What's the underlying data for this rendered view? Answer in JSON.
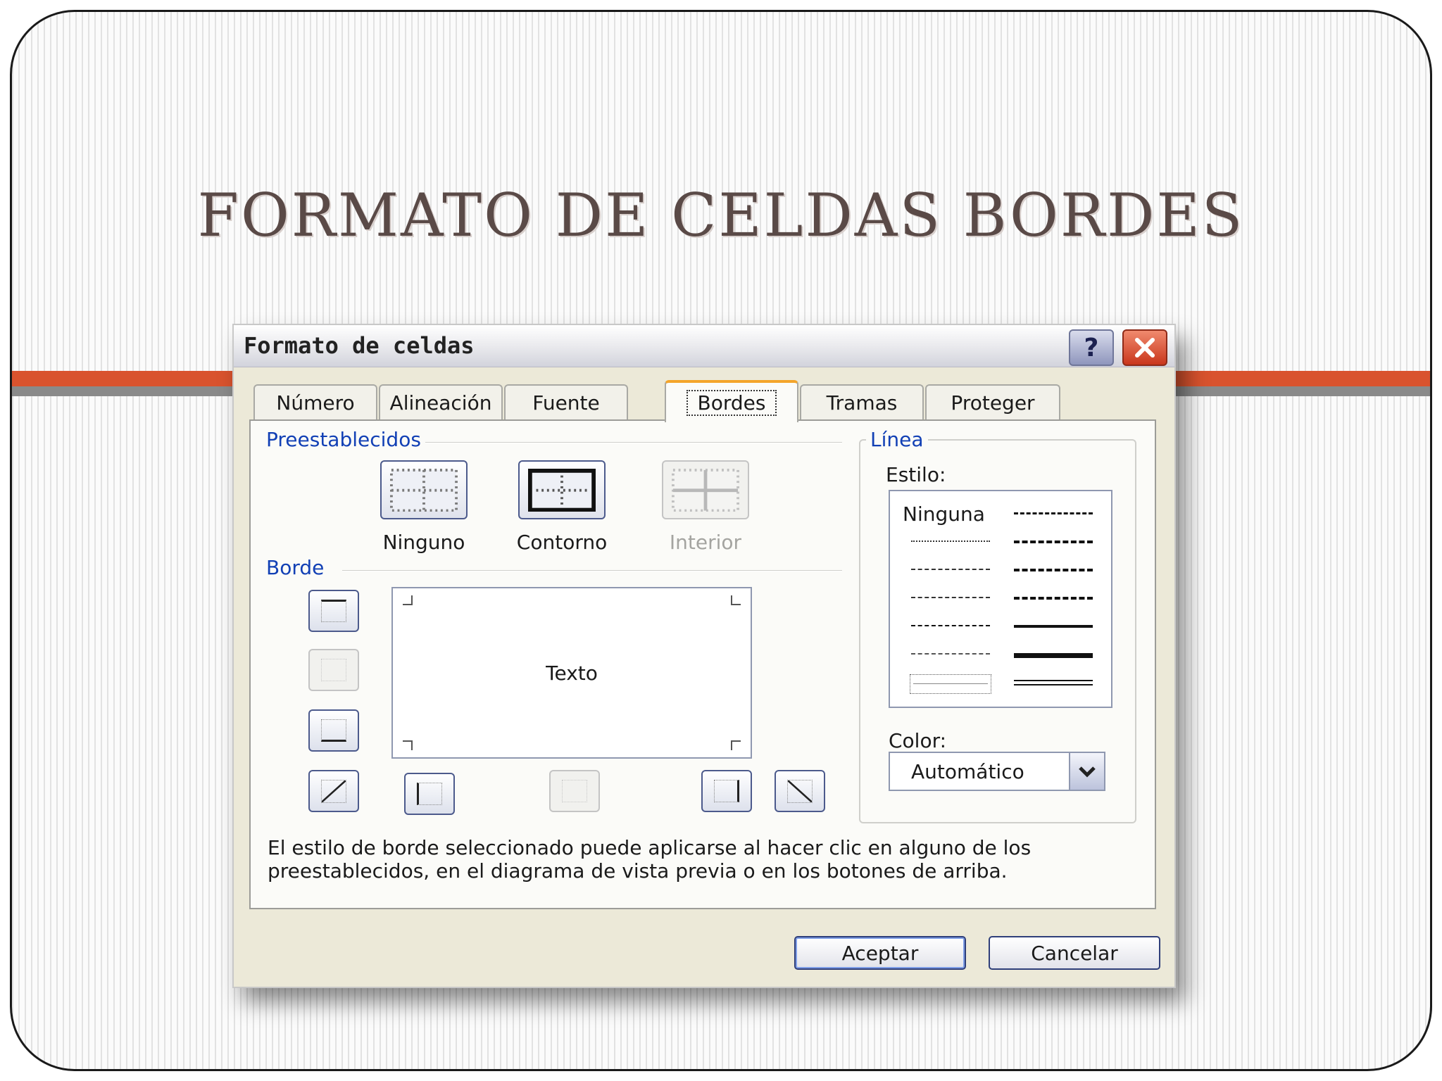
{
  "slide": {
    "title": "FORMATO DE CELDAS BORDES"
  },
  "dialog": {
    "title": "Formato de celdas",
    "help_label": "?",
    "tabs": [
      {
        "label": "Número"
      },
      {
        "label": "Alineación"
      },
      {
        "label": "Fuente"
      },
      {
        "label": "Bordes",
        "active": true
      },
      {
        "label": "Tramas"
      },
      {
        "label": "Proteger"
      }
    ],
    "presets": {
      "group_label": "Preestablecidos",
      "items": [
        {
          "label": "Ninguno",
          "icon": "preset-none-icon"
        },
        {
          "label": "Contorno",
          "icon": "preset-outline-icon"
        },
        {
          "label": "Interior",
          "icon": "preset-inside-icon",
          "disabled": true
        }
      ]
    },
    "border": {
      "group_label": "Borde",
      "preview_text": "Texto"
    },
    "line": {
      "group_label": "Línea",
      "style_label": "Estilo:",
      "none_option": "Ninguna",
      "color_label": "Color:",
      "color_value": "Automático"
    },
    "info_text": "El estilo de borde seleccionado puede aplicarse al hacer clic en alguno de los preestablecidos, en el diagrama de vista previa o en los botones de arriba.",
    "buttons": {
      "ok": "Aceptar",
      "cancel": "Cancelar"
    }
  }
}
